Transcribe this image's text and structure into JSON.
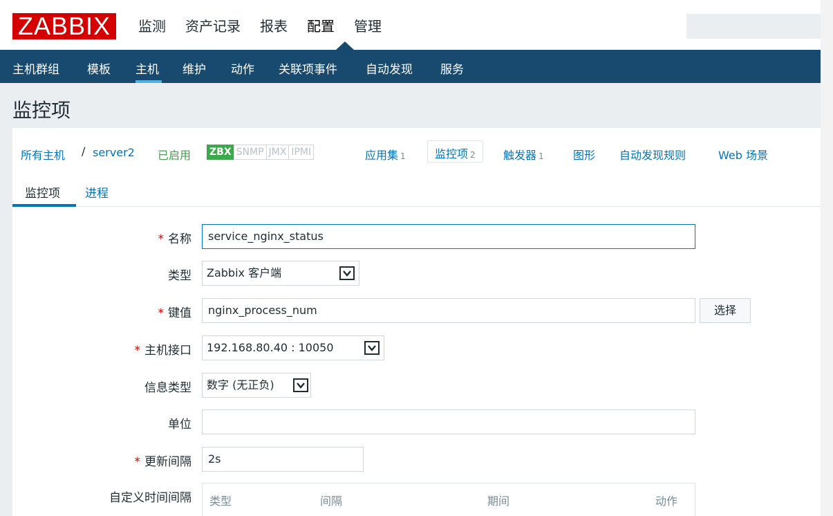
{
  "header": {
    "logo": "ZABBIX",
    "menu": [
      "监测",
      "资产记录",
      "报表",
      "配置",
      "管理"
    ],
    "active_menu": "配置"
  },
  "submenu": {
    "items": [
      "主机群组",
      "模板",
      "主机",
      "维护",
      "动作",
      "关联项事件",
      "自动发现",
      "服务"
    ],
    "active": "主机"
  },
  "page": {
    "title": "监控项"
  },
  "breadcrumbs": {
    "all_hosts": "所有主机",
    "separator": "/",
    "host": "server2",
    "status": "已启用",
    "availability": [
      "ZBX",
      "SNMP",
      "JMX",
      "IPMI"
    ],
    "apps_label": "应用集",
    "apps_count": "1",
    "items_label": "监控项",
    "items_count": "2",
    "triggers_label": "触发器",
    "triggers_count": "1",
    "graphs_label": "图形",
    "discovery_label": "自动发现规则",
    "web_label": "Web 场景"
  },
  "tabs": {
    "item": "监控项",
    "process": "进程"
  },
  "form": {
    "name_label": "名称",
    "name_value": "service_nginx_status",
    "type_label": "类型",
    "type_value": "Zabbix 客户端",
    "key_label": "键值",
    "key_value": "nginx_process_num",
    "select_button": "选择",
    "interface_label": "主机接口",
    "interface_value": "192.168.80.40 : 10050",
    "info_type_label": "信息类型",
    "info_type_value": "数字 (无正负)",
    "units_label": "单位",
    "units_value": "",
    "interval_label": "更新间隔",
    "interval_value": "2s",
    "custom_interval_label": "自定义时间间隔",
    "custom_cols": [
      "类型",
      "间隔",
      "期间",
      "动作"
    ]
  },
  "colors": {
    "brand": "#d40000",
    "nav": "#184a6f",
    "link": "#0275b8",
    "enabled": "#429e47"
  }
}
